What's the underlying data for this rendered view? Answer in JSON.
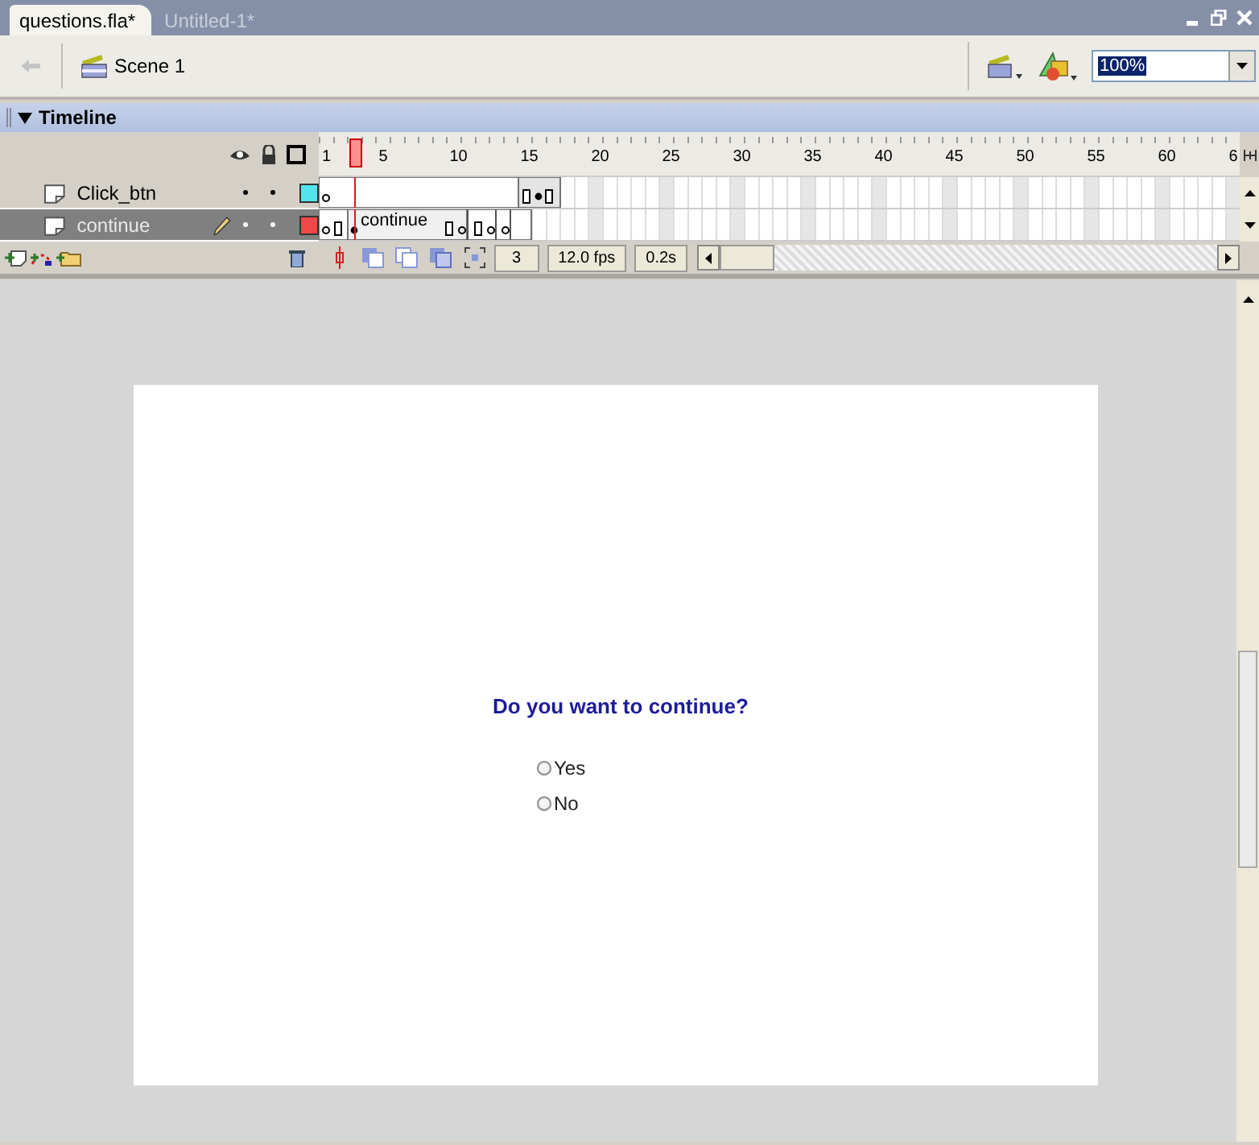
{
  "document_tabs": [
    {
      "label": "questions.fla*",
      "selected": true
    },
    {
      "label": "Untitled-1*",
      "selected": false
    }
  ],
  "toolbar": {
    "scene": "Scene 1",
    "zoom": "100%"
  },
  "timeline": {
    "title": "Timeline",
    "expanded": true,
    "ruler": [
      "1",
      "5",
      "10",
      "15",
      "20",
      "25",
      "30",
      "35",
      "40",
      "45",
      "50",
      "55",
      "60",
      "6"
    ],
    "layers": [
      {
        "name": "Click_btn",
        "selected": false,
        "color": "#55e4ec"
      },
      {
        "name": "continue",
        "selected": true,
        "color": "#f04848",
        "frame_label": "continue"
      }
    ],
    "current_frame": "3",
    "frame_rate": "12.0 fps",
    "elapsed_time": "0.2s"
  },
  "stage": {
    "question": "Do you want to continue?",
    "options": [
      {
        "label": "Yes",
        "selected": false
      },
      {
        "label": "No",
        "selected": false
      }
    ]
  }
}
